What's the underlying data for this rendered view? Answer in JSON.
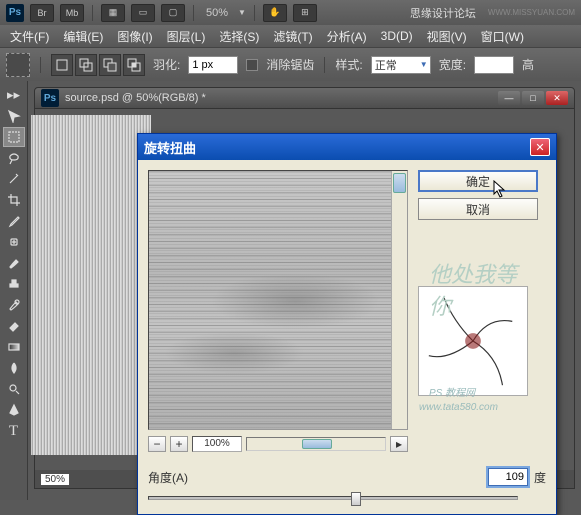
{
  "app": {
    "zoom": "50%",
    "watermark": "思缘设计论坛",
    "watermark_url": "WWW.MISSYUAN.COM"
  },
  "menu": {
    "file": "文件(F)",
    "edit": "编辑(E)",
    "image": "图像(I)",
    "layer": "图层(L)",
    "select": "选择(S)",
    "filter": "滤镜(T)",
    "analysis": "分析(A)",
    "threeD": "3D(D)",
    "view": "视图(V)",
    "window": "窗口(W)"
  },
  "options": {
    "feather_label": "羽化:",
    "feather_value": "1 px",
    "antialias": "消除锯齿",
    "style_label": "样式:",
    "style_value": "正常",
    "width_label": "宽度:",
    "height_label": "高"
  },
  "document": {
    "title": "source.psd @ 50%(RGB/8) *",
    "status_zoom": "50%"
  },
  "dialog": {
    "title": "旋转扭曲",
    "ok": "确定",
    "cancel": "取消",
    "zoom": "100%",
    "angle_label": "角度(A)",
    "angle_value": "109",
    "angle_unit": "度"
  },
  "wm": {
    "text": "他处我等你",
    "small": "PS 教程网",
    "url": "www.tata580.com"
  }
}
